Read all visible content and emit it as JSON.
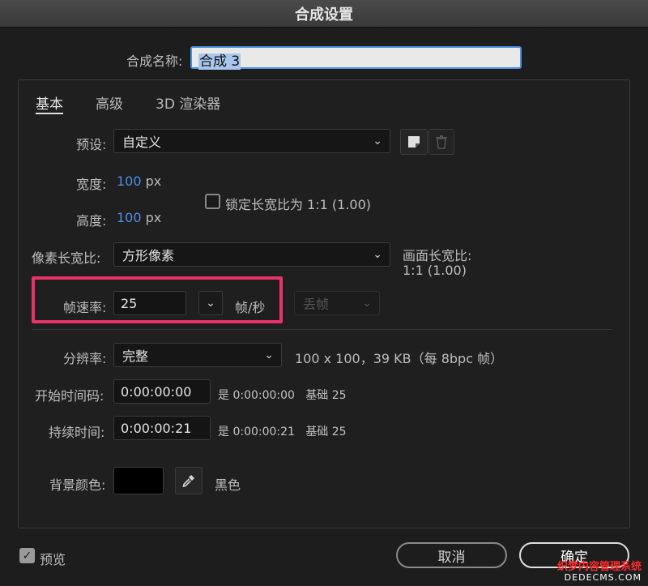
{
  "window": {
    "title": "合成设置"
  },
  "comp_name": {
    "label": "合成名称:",
    "value": "合成 3"
  },
  "tabs": [
    {
      "label": "基本",
      "active": true
    },
    {
      "label": "高级",
      "active": false
    },
    {
      "label": "3D 渲染器",
      "active": false
    }
  ],
  "preset": {
    "label": "预设:",
    "value": "自定义"
  },
  "width": {
    "label": "宽度:",
    "value": "100",
    "unit": "px"
  },
  "height": {
    "label": "高度:",
    "value": "100",
    "unit": "px"
  },
  "lock_aspect": {
    "label": "锁定长宽比为 1:1 (1.00)",
    "checked": false
  },
  "pixel_aspect": {
    "label": "像素长宽比:",
    "value": "方形像素"
  },
  "frame_aspect": {
    "label": "画面长宽比:",
    "value": "1:1 (1.00)"
  },
  "frame_rate": {
    "label": "帧速率:",
    "value": "25",
    "unit": "帧/秒",
    "drop_frame": "丢帧"
  },
  "resolution": {
    "label": "分辨率:",
    "value": "完整",
    "info": "100 x 100，39 KB（每 8bpc 帧）"
  },
  "start_timecode": {
    "label": "开始时间码:",
    "value": "0:00:00:00",
    "info_prefix": "是 0:00:00:00",
    "info_base": "基础 25"
  },
  "duration": {
    "label": "持续时间:",
    "value": "0:00:00:21",
    "info_prefix": "是 0:00:00:21",
    "info_base": "基础 25"
  },
  "bg_color": {
    "label": "背景颜色:",
    "name": "黑色",
    "swatch": "#000000"
  },
  "preview": {
    "label": "预览",
    "checked": true
  },
  "buttons": {
    "cancel": "取消",
    "ok": "确定"
  },
  "watermark": {
    "line1": "织梦内容管理系统",
    "line2": "DEDECMS.COM"
  },
  "colors": {
    "accent": "#4a8fe0",
    "highlight": "#e8326a",
    "value_blue": "#4f8fe6"
  }
}
